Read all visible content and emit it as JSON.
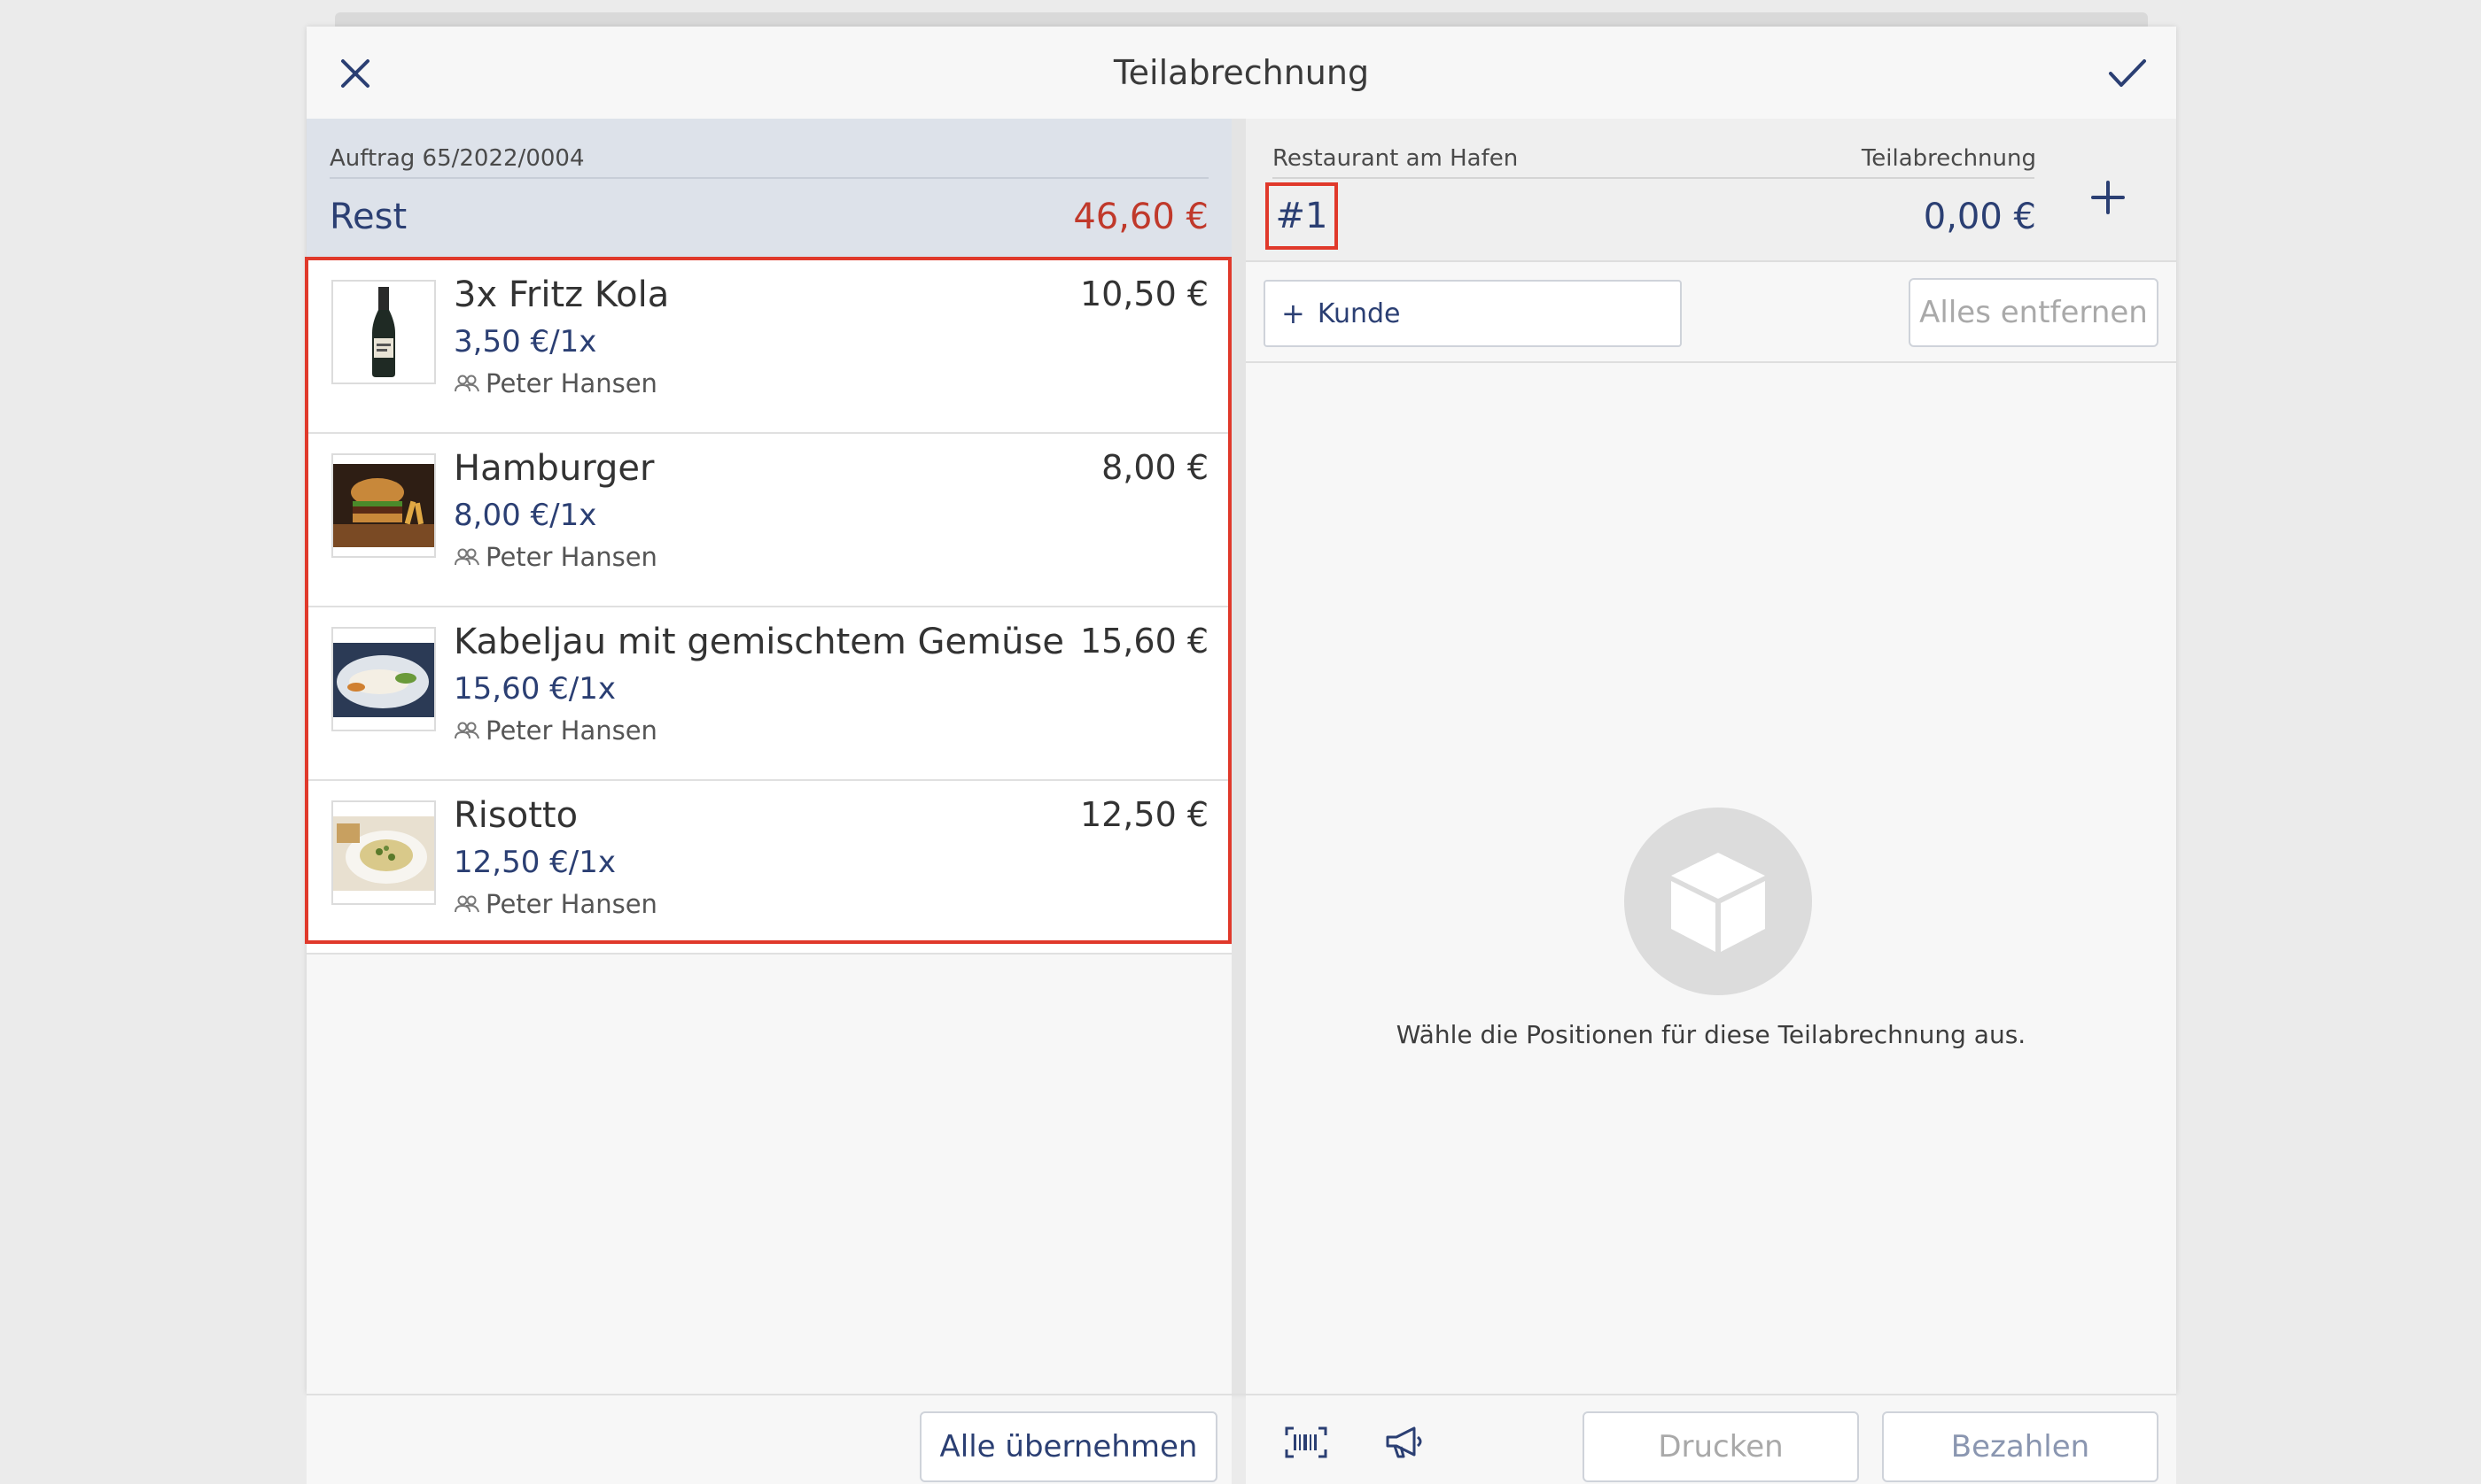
{
  "header": {
    "title": "Teilabrechnung",
    "close_icon": "close-icon",
    "confirm_icon": "checkmark-icon"
  },
  "order": {
    "label": "Auftrag 65/2022/0004",
    "rest_label": "Rest",
    "rest_amount": "46,60 €"
  },
  "items": [
    {
      "name": "3x Fritz Kola",
      "unit_price": "3,50 €/1x",
      "person": "Peter Hansen",
      "price": "10,50 €",
      "image": "cola-bottle"
    },
    {
      "name": "Hamburger",
      "unit_price": "8,00 €/1x",
      "person": "Peter Hansen",
      "price": "8,00 €",
      "image": "burger"
    },
    {
      "name": "Kabeljau mit gemischtem Gemüse",
      "unit_price": "15,60 €/1x",
      "person": "Peter Hansen",
      "price": "15,60 €",
      "image": "fish-plate"
    },
    {
      "name": "Risotto",
      "unit_price": "12,50 €/1x",
      "person": "Peter Hansen",
      "price": "12,50 €",
      "image": "risotto-plate"
    }
  ],
  "left_footer": {
    "take_all_label": "Alle übernehmen"
  },
  "bill": {
    "restaurant": "Restaurant am Hafen",
    "type_label": "Teilabrechnung",
    "number": "#1",
    "amount": "0,00 €"
  },
  "toolbar": {
    "customer_label": "Kunde",
    "remove_all_label": "Alles entfernen"
  },
  "empty_state": {
    "text": "Wähle die Positionen für diese Teilabrechnung aus.",
    "icon": "box-icon"
  },
  "right_footer": {
    "print_label": "Drucken",
    "pay_label": "Bezahlen"
  },
  "colors": {
    "accent": "#2b3f73",
    "highlight": "#e0392b",
    "rest_amount": "#c0392b"
  }
}
